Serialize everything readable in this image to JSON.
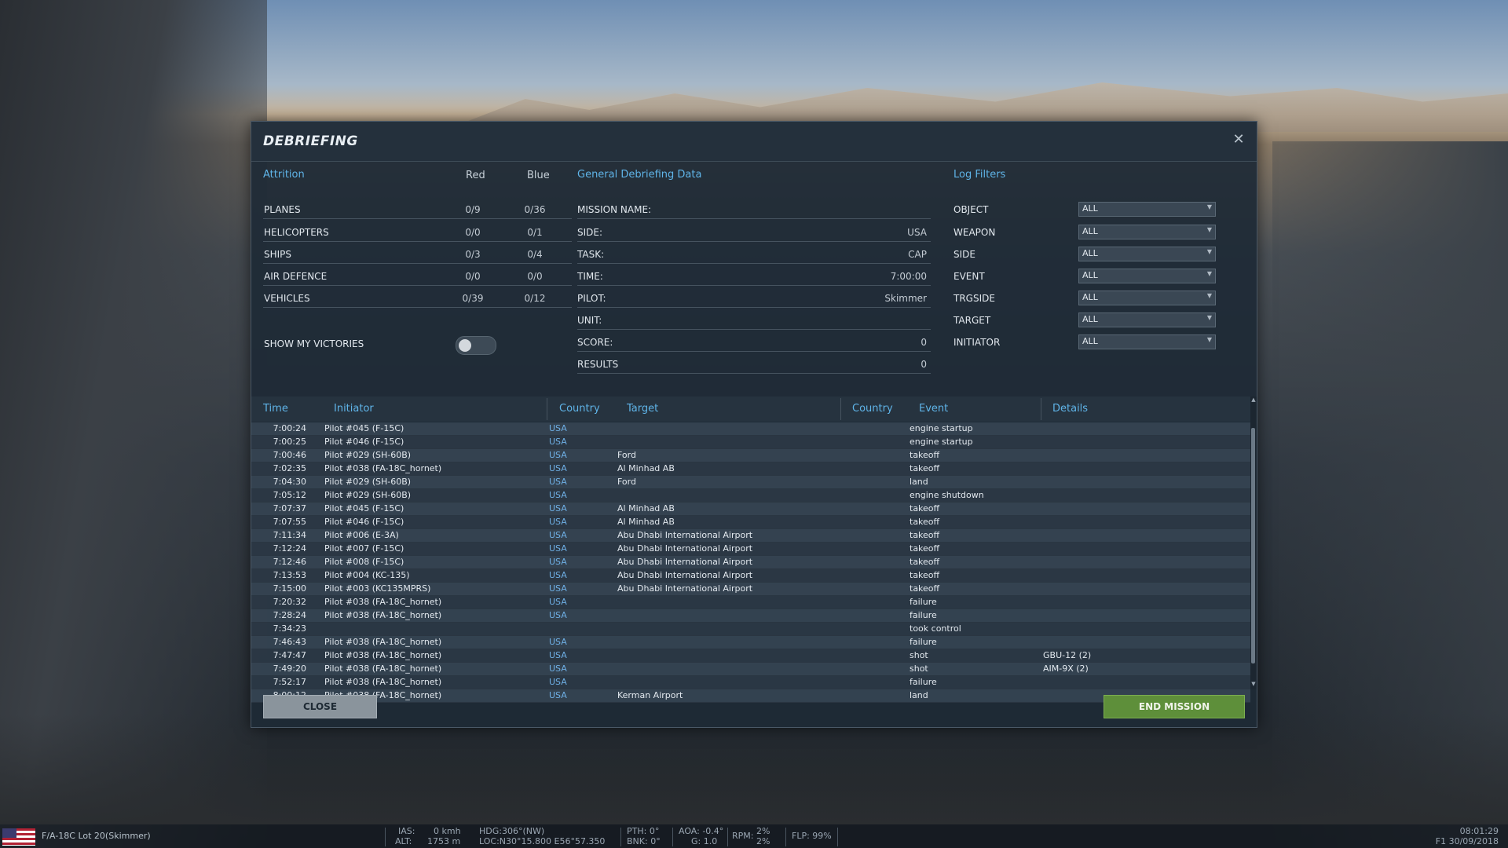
{
  "dialog": {
    "title": "DEBRIEFING"
  },
  "attrition": {
    "title": "Attrition",
    "col_red": "Red",
    "col_blue": "Blue",
    "rows": [
      {
        "label": "PLANES",
        "red": "0/9",
        "blue": "0/36"
      },
      {
        "label": "HELICOPTERS",
        "red": "0/0",
        "blue": "0/1"
      },
      {
        "label": "SHIPS",
        "red": "0/3",
        "blue": "0/4"
      },
      {
        "label": "AIR DEFENCE",
        "red": "0/0",
        "blue": "0/0"
      },
      {
        "label": "VEHICLES",
        "red": "0/39",
        "blue": "0/12"
      }
    ],
    "show_victories_label": "SHOW MY VICTORIES",
    "show_victories_on": false
  },
  "general": {
    "title": "General Debriefing Data",
    "rows": [
      {
        "label": "MISSION NAME:",
        "value": ""
      },
      {
        "label": "SIDE:",
        "value": "USA"
      },
      {
        "label": "TASK:",
        "value": "CAP"
      },
      {
        "label": "TIME:",
        "value": "7:00:00"
      },
      {
        "label": "PILOT:",
        "value": "Skimmer"
      },
      {
        "label": "UNIT:",
        "value": ""
      },
      {
        "label": "SCORE:",
        "value": "0"
      },
      {
        "label": "RESULTS",
        "value": "0"
      }
    ]
  },
  "filters": {
    "title": "Log Filters",
    "rows": [
      {
        "label": "OBJECT",
        "value": "ALL"
      },
      {
        "label": "WEAPON",
        "value": "ALL"
      },
      {
        "label": "SIDE",
        "value": "ALL"
      },
      {
        "label": "EVENT",
        "value": "ALL"
      },
      {
        "label": "TRGSIDE",
        "value": "ALL"
      },
      {
        "label": "TARGET",
        "value": "ALL"
      },
      {
        "label": "INITIATOR",
        "value": "ALL"
      }
    ]
  },
  "log": {
    "headers": {
      "time": "Time",
      "initiator": "Initiator",
      "country": "Country",
      "target": "Target",
      "target_country": "Country",
      "event": "Event",
      "details": "Details"
    },
    "rows": [
      {
        "time": "7:00:24",
        "initiator": "Pilot #045 (F-15C)",
        "country": "USA",
        "target": "",
        "target_country": "",
        "event": "engine startup",
        "details": ""
      },
      {
        "time": "7:00:25",
        "initiator": "Pilot #046 (F-15C)",
        "country": "USA",
        "target": "",
        "target_country": "",
        "event": "engine startup",
        "details": ""
      },
      {
        "time": "7:00:46",
        "initiator": "Pilot #029 (SH-60B)",
        "country": "USA",
        "target": "Ford",
        "target_country": "",
        "event": "takeoff",
        "details": ""
      },
      {
        "time": "7:02:35",
        "initiator": "Pilot #038 (FA-18C_hornet)",
        "country": "USA",
        "target": "Al Minhad AB",
        "target_country": "",
        "event": "takeoff",
        "details": ""
      },
      {
        "time": "7:04:30",
        "initiator": "Pilot #029 (SH-60B)",
        "country": "USA",
        "target": "Ford",
        "target_country": "",
        "event": "land",
        "details": ""
      },
      {
        "time": "7:05:12",
        "initiator": "Pilot #029 (SH-60B)",
        "country": "USA",
        "target": "",
        "target_country": "",
        "event": "engine shutdown",
        "details": ""
      },
      {
        "time": "7:07:37",
        "initiator": "Pilot #045 (F-15C)",
        "country": "USA",
        "target": "Al Minhad AB",
        "target_country": "",
        "event": "takeoff",
        "details": ""
      },
      {
        "time": "7:07:55",
        "initiator": "Pilot #046 (F-15C)",
        "country": "USA",
        "target": "Al Minhad AB",
        "target_country": "",
        "event": "takeoff",
        "details": ""
      },
      {
        "time": "7:11:34",
        "initiator": "Pilot #006 (E-3A)",
        "country": "USA",
        "target": "Abu Dhabi International Airport",
        "target_country": "",
        "event": "takeoff",
        "details": ""
      },
      {
        "time": "7:12:24",
        "initiator": "Pilot #007 (F-15C)",
        "country": "USA",
        "target": "Abu Dhabi International Airport",
        "target_country": "",
        "event": "takeoff",
        "details": ""
      },
      {
        "time": "7:12:46",
        "initiator": "Pilot #008 (F-15C)",
        "country": "USA",
        "target": "Abu Dhabi International Airport",
        "target_country": "",
        "event": "takeoff",
        "details": ""
      },
      {
        "time": "7:13:53",
        "initiator": "Pilot #004 (KC-135)",
        "country": "USA",
        "target": "Abu Dhabi International Airport",
        "target_country": "",
        "event": "takeoff",
        "details": ""
      },
      {
        "time": "7:15:00",
        "initiator": "Pilot #003 (KC135MPRS)",
        "country": "USA",
        "target": "Abu Dhabi International Airport",
        "target_country": "",
        "event": "takeoff",
        "details": ""
      },
      {
        "time": "7:20:32",
        "initiator": "Pilot #038 (FA-18C_hornet)",
        "country": "USA",
        "target": "",
        "target_country": "",
        "event": "failure",
        "details": ""
      },
      {
        "time": "7:28:24",
        "initiator": "Pilot #038 (FA-18C_hornet)",
        "country": "USA",
        "target": "",
        "target_country": "",
        "event": "failure",
        "details": ""
      },
      {
        "time": "7:34:23",
        "initiator": "",
        "country": "",
        "target": "",
        "target_country": "",
        "event": "took control",
        "details": ""
      },
      {
        "time": "7:46:43",
        "initiator": "Pilot #038 (FA-18C_hornet)",
        "country": "USA",
        "target": "",
        "target_country": "",
        "event": "failure",
        "details": ""
      },
      {
        "time": "7:47:47",
        "initiator": "Pilot #038 (FA-18C_hornet)",
        "country": "USA",
        "target": "",
        "target_country": "",
        "event": "shot",
        "details": "GBU-12 (2)"
      },
      {
        "time": "7:49:20",
        "initiator": "Pilot #038 (FA-18C_hornet)",
        "country": "USA",
        "target": "",
        "target_country": "",
        "event": "shot",
        "details": "AIM-9X (2)"
      },
      {
        "time": "7:52:17",
        "initiator": "Pilot #038 (FA-18C_hornet)",
        "country": "USA",
        "target": "",
        "target_country": "",
        "event": "failure",
        "details": ""
      },
      {
        "time": "8:00:12",
        "initiator": "Pilot #038 (FA-18C_hornet)",
        "country": "USA",
        "target": "Kerman Airport",
        "target_country": "",
        "event": "land",
        "details": ""
      }
    ]
  },
  "buttons": {
    "close": "CLOSE",
    "end_mission": "END MISSION"
  },
  "statusbar": {
    "aircraft": "F/A-18C Lot 20(Skimmer)",
    "ias_label": "IAS:",
    "ias_value": "0 kmh",
    "alt_label": "ALT:",
    "alt_value": "1753 m",
    "hdg": "HDG:306°(NW)",
    "loc": "LOC:N30°15.800 E56°57.350",
    "pth": "PTH: 0°",
    "bnk": "BNK: 0°",
    "aoa": "AOA: -0.4°",
    "g": "G: 1.0",
    "rpm_label": "RPM:",
    "rpm1": "2%",
    "rpm2": "2%",
    "flp": "FLP: 99%",
    "clock": "08:01:29",
    "date": "F1 30/09/2018"
  }
}
